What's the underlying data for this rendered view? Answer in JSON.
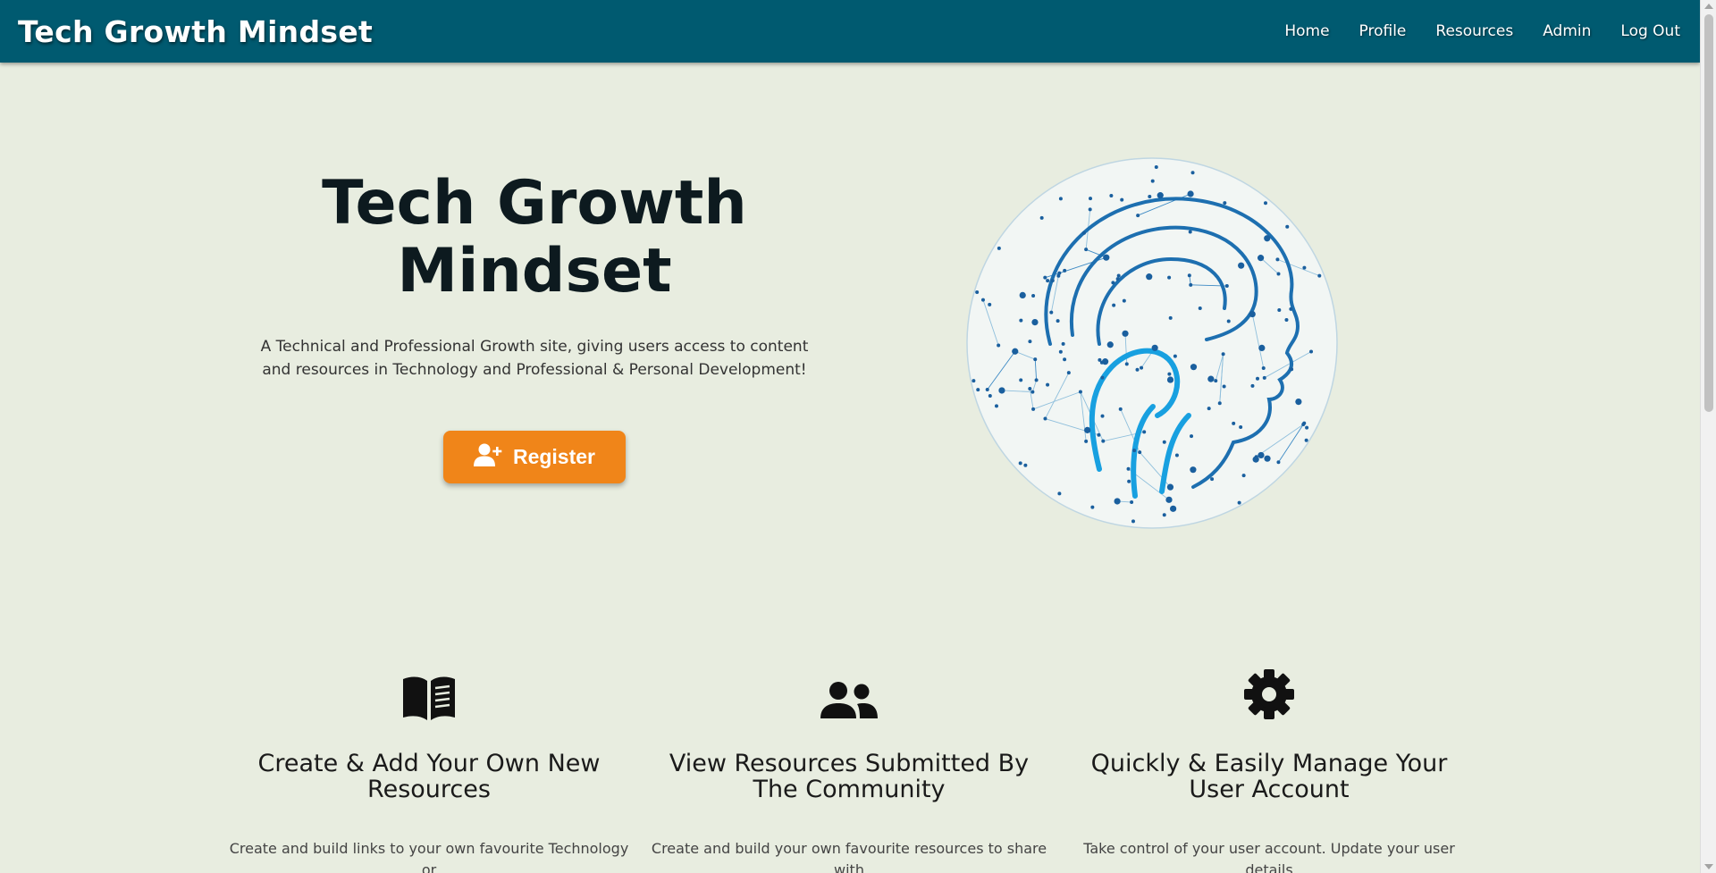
{
  "navbar": {
    "brand": "Tech Growth Mindset",
    "links": [
      {
        "label": "Home"
      },
      {
        "label": "Profile"
      },
      {
        "label": "Resources"
      },
      {
        "label": "Admin"
      },
      {
        "label": "Log Out"
      }
    ]
  },
  "hero": {
    "title": "Tech Growth Mindset",
    "description": "A Technical and Professional Growth site, giving users access to content and resources in Technology and Professional & Personal Development!",
    "register_label": "Register"
  },
  "features": [
    {
      "icon": "book-open-icon",
      "title": "Create & Add Your Own New Resources",
      "text": "Create and build links to your own favourite Technology or"
    },
    {
      "icon": "users-icon",
      "title": "View Resources Submitted By The Community",
      "text": "Create and build your own favourite resources to share with"
    },
    {
      "icon": "gear-icon",
      "title": "Quickly & Easily Manage Your User Account",
      "text": "Take control of your user account. Update your user details"
    }
  ],
  "colors": {
    "navbar": "#005a70",
    "background": "#e8ede0",
    "accent": "#f08519",
    "brain_blue": "#1a8fd8"
  }
}
